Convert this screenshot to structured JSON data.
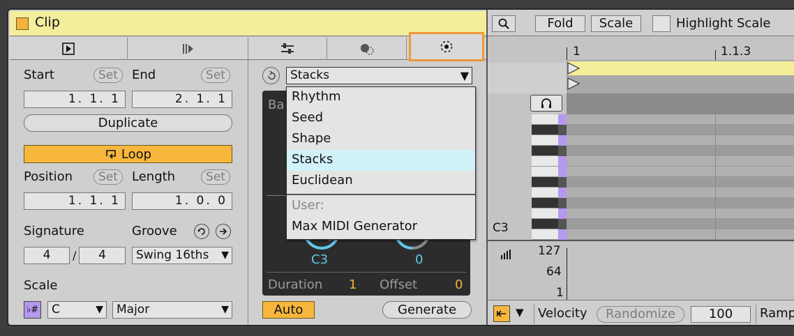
{
  "clip": {
    "title": "Clip"
  },
  "left": {
    "start_label": "Start",
    "end_label": "End",
    "set_label": "Set",
    "start_value": "1. 1. 1",
    "end_value": "2. 1. 1",
    "duplicate_label": "Duplicate",
    "loop_label": "Loop",
    "position_label": "Position",
    "length_label": "Length",
    "position_value": "1. 1. 1",
    "length_value": "1. 0. 0",
    "signature_label": "Signature",
    "groove_label": "Groove",
    "sig_num": "4",
    "sig_den": "4",
    "sig_sep": "/",
    "groove_value": "Swing 16ths",
    "scale_label": "Scale",
    "scale_icon": "♭#",
    "scale_root": "C",
    "scale_mode": "Major"
  },
  "generator": {
    "selected": "Stacks",
    "panel_partial_label": "Ba",
    "knob1_value": "C3",
    "knob2_value": "0",
    "duration_label": "Duration",
    "duration_value": "1",
    "offset_label": "Offset",
    "offset_value": "0",
    "auto_label": "Auto",
    "generate_label": "Generate",
    "menu": {
      "items": [
        "Rhythm",
        "Seed",
        "Shape",
        "Stacks",
        "Euclidean"
      ],
      "highlighted": "Stacks",
      "section_label": "User:",
      "user_items": [
        "Max MIDI Generator"
      ]
    }
  },
  "editor": {
    "fold_label": "Fold",
    "scale_label": "Scale",
    "highlight_label": "Highlight Scale",
    "ruler_1": "1",
    "ruler_2": "1.1.3",
    "key_label": "C3",
    "vel_127": "127",
    "vel_64": "64",
    "vel_1": "1",
    "velocity_label": "Velocity",
    "randomize_label": "Randomize",
    "velocity_value": "100",
    "ramp_label": "Ramp"
  },
  "colors": {
    "accent": "#f7b73c",
    "clip_yellow": "#f3ee9c",
    "highlight": "#d2f2fa",
    "knob_blue": "#63c7e8",
    "value_orange": "#f3b33d",
    "piano_purple": "#b698ee",
    "focus_orange": "#f1973a"
  }
}
